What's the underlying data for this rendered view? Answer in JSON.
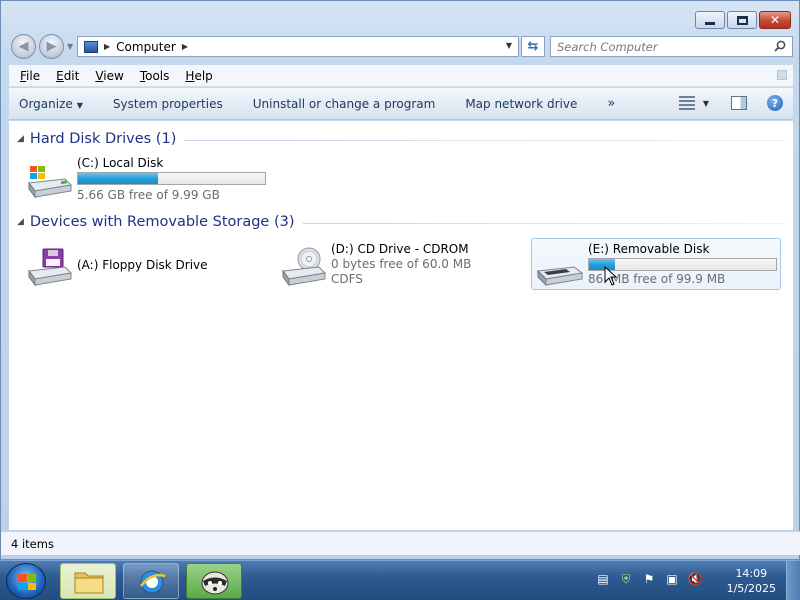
{
  "window": {
    "controls": {
      "minimize": "minimize",
      "maximize": "maximize",
      "close": "close"
    }
  },
  "navigation": {
    "back_icon": "back-arrow-icon",
    "forward_icon": "forward-arrow-icon",
    "address_path": [
      "Computer"
    ],
    "search_placeholder": "Search Computer"
  },
  "menubar": {
    "items": [
      {
        "label": "File",
        "mnemonic": "F"
      },
      {
        "label": "Edit",
        "mnemonic": "E"
      },
      {
        "label": "View",
        "mnemonic": "V"
      },
      {
        "label": "Tools",
        "mnemonic": "T"
      },
      {
        "label": "Help",
        "mnemonic": "H"
      }
    ]
  },
  "commandbar": {
    "organize": "Organize",
    "system_properties": "System properties",
    "uninstall": "Uninstall or change a program",
    "map_drive": "Map network drive",
    "overflow": "»"
  },
  "groups": {
    "hard_disk": {
      "title": "Hard Disk Drives (1)",
      "drives": [
        {
          "label": "(C:) Local Disk",
          "free": "5.66 GB free of 9.99 GB",
          "used_fraction": 0.43
        }
      ]
    },
    "removable": {
      "title": "Devices with Removable Storage (3)",
      "drives": [
        {
          "label": "(A:) Floppy Disk Drive"
        },
        {
          "label": "(D:) CD Drive - CDROM",
          "free": "0 bytes free of 60.0 MB",
          "filesystem": "CDFS"
        },
        {
          "label": "(E:) Removable Disk",
          "free": "86.  MB free of 99.9 MB",
          "used_fraction": 0.14
        }
      ]
    }
  },
  "status": {
    "items": "4 items"
  },
  "taskbar": {
    "time": "14:09",
    "date": "1/5/2025"
  },
  "colors": {
    "group_title": "#1e3287",
    "usage_bar": "#26a0da",
    "close_button": "#c34a36"
  }
}
